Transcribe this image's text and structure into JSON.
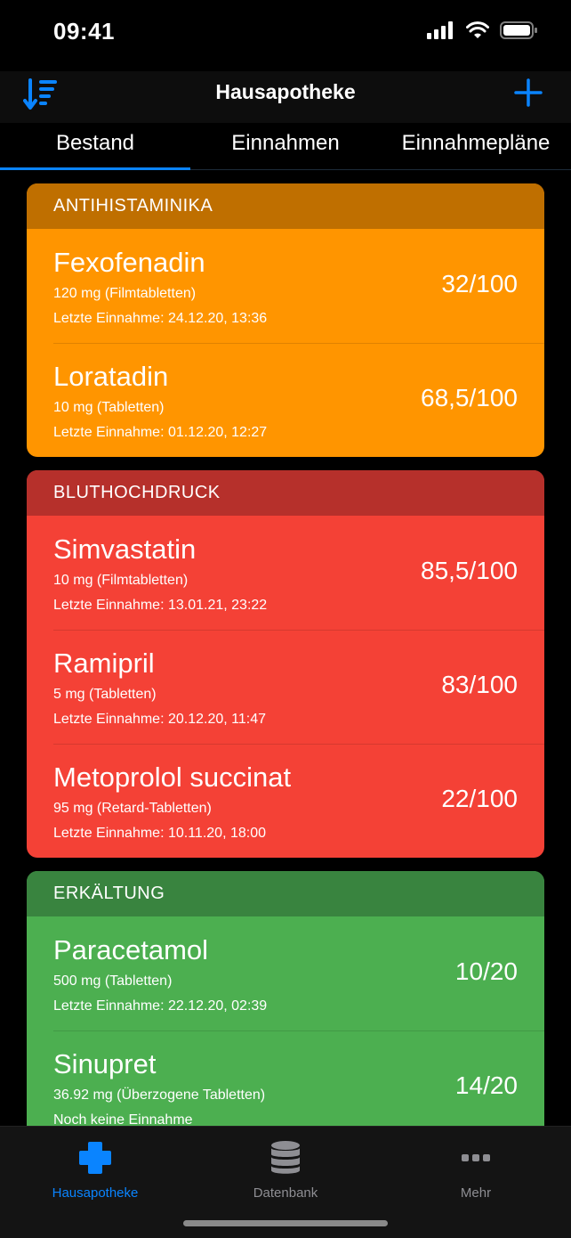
{
  "status": {
    "time": "09:41"
  },
  "nav": {
    "title": "Hausapotheke",
    "sort_icon": "sort-descending-icon",
    "add_icon": "plus-icon"
  },
  "tabs": [
    {
      "label": "Bestand",
      "selected": true
    },
    {
      "label": "Einnahmen",
      "selected": false
    },
    {
      "label": "Einnahmepläne",
      "selected": false
    }
  ],
  "sections": [
    {
      "title": "ANTIHISTAMINIKA",
      "header_color": "#bf6f00",
      "body_color": "#ff9500",
      "items": [
        {
          "name": "Fexofenadin",
          "dose": "120 mg (Filmtabletten)",
          "last": "Letzte Einnahme: 24.12.20, 13:36",
          "stock": "32/100"
        },
        {
          "name": "Loratadin",
          "dose": "10 mg (Tabletten)",
          "last": "Letzte Einnahme: 01.12.20, 12:27",
          "stock": "68,5/100"
        }
      ]
    },
    {
      "title": "BLUTHOCHDRUCK",
      "header_color": "#b6302b",
      "body_color": "#f44136",
      "items": [
        {
          "name": "Simvastatin",
          "dose": "10 mg (Filmtabletten)",
          "last": "Letzte Einnahme: 13.01.21, 23:22",
          "stock": "85,5/100"
        },
        {
          "name": "Ramipril",
          "dose": "5 mg (Tabletten)",
          "last": "Letzte Einnahme: 20.12.20, 11:47",
          "stock": "83/100"
        },
        {
          "name": "Metoprolol succinat",
          "dose": "95 mg (Retard-Tabletten)",
          "last": "Letzte Einnahme: 10.11.20, 18:00",
          "stock": "22/100"
        }
      ]
    },
    {
      "title": "ERKÄLTUNG",
      "header_color": "#39843f",
      "body_color": "#4caf50",
      "items": [
        {
          "name": "Paracetamol",
          "dose": "500 mg (Tabletten)",
          "last": "Letzte Einnahme: 22.12.20, 02:39",
          "stock": "10/20"
        },
        {
          "name": "Sinupret",
          "dose": "36.92 mg (Überzogene Tabletten)",
          "last": "Noch keine Einnahme",
          "stock": "14/20"
        }
      ]
    }
  ],
  "tabbar": [
    {
      "label": "Hausapotheke",
      "icon": "medical-cross-icon",
      "selected": true,
      "color": "#0a84ff"
    },
    {
      "label": "Datenbank",
      "icon": "database-icon",
      "selected": false,
      "color": "#8e8e93"
    },
    {
      "label": "Mehr",
      "icon": "more-dots-icon",
      "selected": false,
      "color": "#8e8e93"
    }
  ],
  "colors": {
    "accent": "#0a84ff",
    "inactive": "#8e8e93"
  }
}
